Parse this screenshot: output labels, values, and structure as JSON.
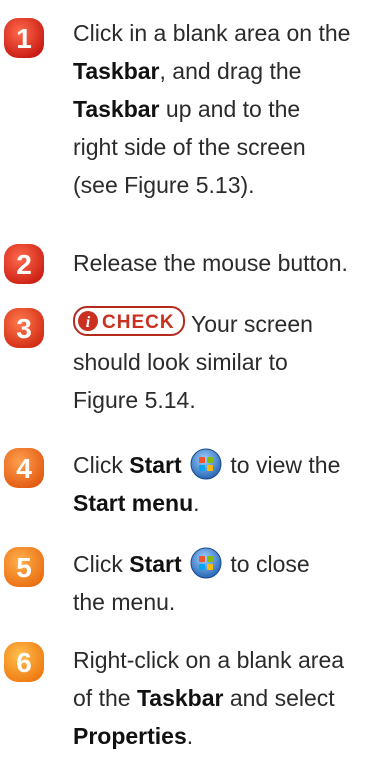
{
  "colors": {
    "step_badge_red": "#d9261c",
    "step_badge_orange": "#ef7a1a",
    "check_badge": "#c9301f",
    "start_orb_blue": "#3a7fd0",
    "text": "#2b2b2b"
  },
  "steps": [
    {
      "number": "1",
      "line1_a": "Click in a blank area on the",
      "line2_bold": "Taskbar",
      "line2_b": ", and drag the",
      "line3_bold": "Taskbar",
      "line3_b": " up and to the",
      "line4": "right side of the screen",
      "line5": "(see Figure 5.13)."
    },
    {
      "number": "2",
      "line1": "Release the mouse button."
    },
    {
      "number": "3",
      "check_label": "CHECK",
      "line1": "Your screen",
      "line2": "should look similar to",
      "line3": "Figure 5.14."
    },
    {
      "number": "4",
      "line1_a": "Click ",
      "line1_bold": "Start",
      "line1_b": " to view the",
      "line2_bold": "Start menu",
      "line2_b": "."
    },
    {
      "number": "5",
      "line1_a": "Click ",
      "line1_bold": "Start",
      "line1_b": " to close",
      "line2": "the menu."
    },
    {
      "number": "6",
      "line1": "Right-click on a blank area",
      "line2_a": "of the ",
      "line2_bold": "Taskbar",
      "line2_b": " and select",
      "line3_bold": "Properties",
      "line3_b": "."
    }
  ]
}
